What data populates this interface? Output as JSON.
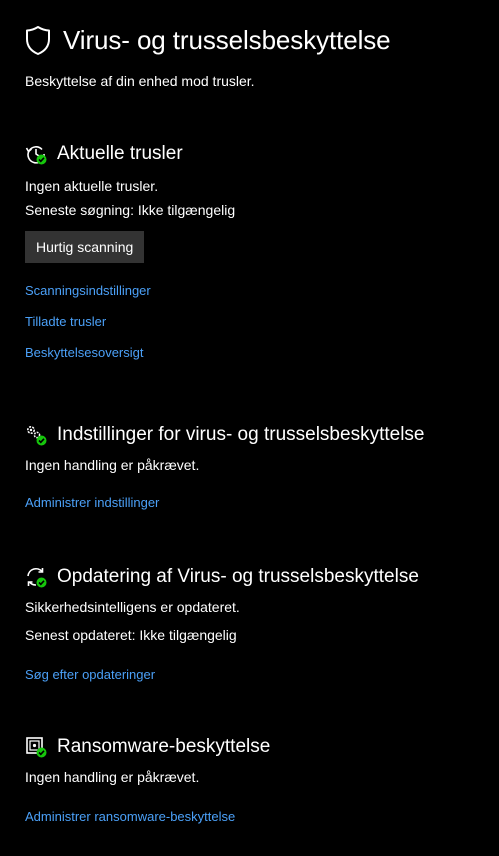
{
  "header": {
    "title": "Virus- og trusselsbeskyttelse",
    "subtitle": "Beskyttelse af din enhed mod trusler.",
    "icon": "shield-icon"
  },
  "sections": {
    "current_threats": {
      "icon": "history-check-icon",
      "title": "Aktuelle trusler",
      "status": "Ingen aktuelle trusler.",
      "last_scan": "Seneste søgning: Ikke tilgængelig",
      "button": "Hurtig scanning",
      "links": [
        "Scanningsindstillinger",
        "Tilladte trusler",
        "Beskyttelsesoversigt"
      ]
    },
    "settings": {
      "icon": "gears-check-icon",
      "title": "Indstillinger for virus- og trusselsbeskyttelse",
      "status": "Ingen handling er påkrævet.",
      "link": "Administrer indstillinger"
    },
    "updates": {
      "icon": "refresh-check-icon",
      "title": "Opdatering af Virus- og trusselsbeskyttelse",
      "status": "Sikkerhedsintelligens er opdateret.",
      "last_update": "Senest opdateret: Ikke tilgængelig",
      "link": "Søg efter opdateringer"
    },
    "ransomware": {
      "icon": "ransomware-check-icon",
      "title": "Ransomware-beskyttelse",
      "status": "Ingen handling er påkrævet.",
      "link": "Administrer ransomware-beskyttelse"
    }
  },
  "colors": {
    "background": "#000000",
    "text": "#ffffff",
    "link": "#4ba0f7",
    "button": "#333333",
    "status_ok": "#16c60c"
  }
}
